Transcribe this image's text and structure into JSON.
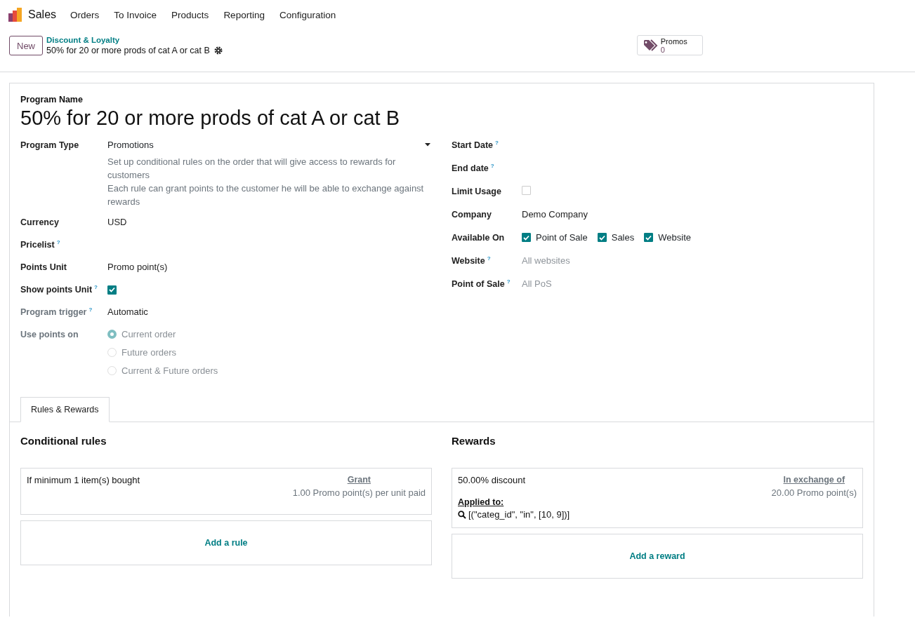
{
  "app": {
    "name": "Sales",
    "menu": [
      "Orders",
      "To Invoice",
      "Products",
      "Reporting",
      "Configuration"
    ]
  },
  "control_panel": {
    "new_button": "New",
    "breadcrumb": "Discount & Loyalty",
    "record_title": "50% for 20 or more prods of cat A or cat B",
    "smart_button": {
      "label": "Promos",
      "count": "0"
    }
  },
  "form": {
    "name_label": "Program Name",
    "name": "50% for 20 or more prods of cat A or cat B",
    "left_fields": [
      {
        "kind": "select",
        "label": "Program Type",
        "muted": false,
        "value": "Promotions",
        "description": [
          "Set up conditional rules on the order that will give access to rewards for customers",
          "Each rule can grant points to the customer he will be able to exchange against rewards"
        ]
      },
      {
        "kind": "text",
        "label": "Currency",
        "muted": false,
        "value": "USD"
      },
      {
        "kind": "empty",
        "label": "Pricelist",
        "tooltip": "?",
        "muted": false
      },
      {
        "kind": "text",
        "label": "Points Unit",
        "muted": false,
        "value": "Promo point(s)"
      },
      {
        "kind": "checkbox",
        "label": "Show points Unit",
        "tooltip": "?",
        "muted": false,
        "checked": true
      },
      {
        "kind": "text",
        "label": "Program trigger",
        "tooltip": "?",
        "muted": true,
        "value": "Automatic"
      },
      {
        "kind": "radio",
        "label": "Use points on",
        "muted": true,
        "options": [
          {
            "label": "Current order",
            "selected": true
          },
          {
            "label": "Future orders",
            "selected": false
          },
          {
            "label": "Current & Future orders",
            "selected": false
          }
        ]
      }
    ],
    "right_fields": [
      {
        "kind": "empty",
        "label": "Start Date",
        "tooltip": "?",
        "muted": false
      },
      {
        "kind": "empty",
        "label": "End date",
        "tooltip": "?",
        "muted": false
      },
      {
        "kind": "checkbox",
        "label": "Limit Usage",
        "muted": false,
        "checked": false
      },
      {
        "kind": "text",
        "label": "Company",
        "muted": false,
        "value": "Demo Company"
      },
      {
        "kind": "checkboxes",
        "label": "Available On",
        "muted": false,
        "options": [
          {
            "label": "Point of Sale",
            "checked": true
          },
          {
            "label": "Sales",
            "checked": true
          },
          {
            "label": "Website",
            "checked": true
          }
        ]
      },
      {
        "kind": "placeholder",
        "label": "Website",
        "tooltip": "?",
        "muted": false,
        "placeholder": "All websites"
      },
      {
        "kind": "placeholder",
        "label": "Point of Sale",
        "tooltip": "?",
        "muted": false,
        "placeholder": "All PoS"
      }
    ],
    "tabs": [
      {
        "label": "Rules & Rewards",
        "selected": true
      }
    ],
    "rules": {
      "title": "Conditional rules",
      "cards": [
        {
          "condition": "If minimum 1 item(s) bought",
          "grant_label": "Grant",
          "grant_value": "1.00 Promo point(s) per unit paid"
        }
      ],
      "add_label": "Add a rule"
    },
    "rewards": {
      "title": "Rewards",
      "cards": [
        {
          "reward": "50.00% discount",
          "exchange_label": "In exchange of",
          "exchange_value": "20.00 Promo point(s)",
          "applied_label": "Applied to:",
          "domain": "[(\"categ_id\", \"in\", [10, 9])]"
        }
      ],
      "add_label": "Add a reward"
    }
  }
}
